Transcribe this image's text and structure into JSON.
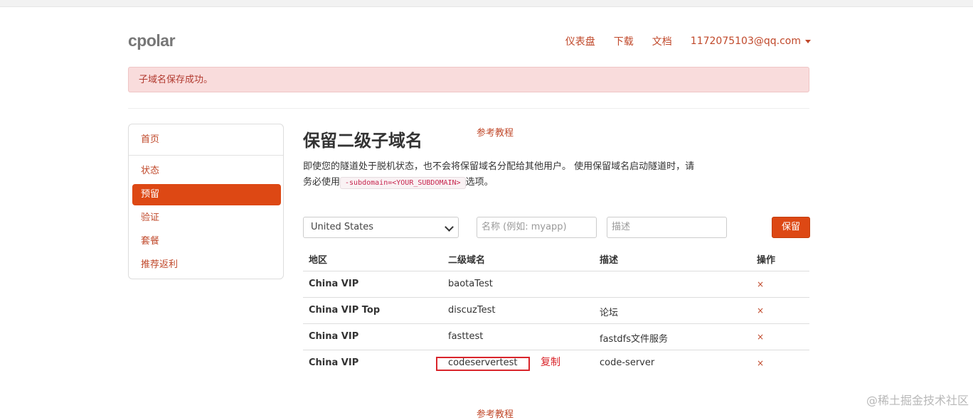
{
  "header": {
    "logo": "cpolar",
    "nav": [
      {
        "label": "仪表盘"
      },
      {
        "label": "下载"
      },
      {
        "label": "文档"
      },
      {
        "label": "1172075103@qq.com"
      }
    ]
  },
  "alert": {
    "text": "子域名保存成功。"
  },
  "sidebar": {
    "items": [
      {
        "label": "首页"
      },
      {
        "label": "状态"
      },
      {
        "label": "预留"
      },
      {
        "label": "验证"
      },
      {
        "label": "套餐"
      },
      {
        "label": "推荐返利"
      }
    ]
  },
  "main": {
    "title": "保留二级子域名",
    "ref_link": "参考教程",
    "desc_part1": "即使您的隧道处于脱机状态，也不会将保留域名分配给其他用户。 使用保留域名启动隧道时，请务必使用",
    "desc_code": "-subdomain=<YOUR_SUBDOMAIN>",
    "desc_part2": "选项。",
    "form": {
      "region_selected": "United States",
      "name_placeholder": "名称 (例如: myapp)",
      "desc_placeholder": "描述",
      "submit_label": "保留"
    },
    "table": {
      "headers": [
        "地区",
        "二级域名",
        "描述",
        "操作"
      ],
      "rows": [
        {
          "region": "China VIP",
          "subdomain": "baotaTest",
          "desc": "",
          "action": "×"
        },
        {
          "region": "China VIP Top",
          "subdomain": "discuzTest",
          "desc": "论坛",
          "action": "×"
        },
        {
          "region": "China VIP",
          "subdomain": "fasttest",
          "desc": "fastdfs文件服务",
          "action": "×"
        },
        {
          "region": "China VIP",
          "subdomain": "codeservertest",
          "desc": "code-server",
          "action": "×"
        }
      ]
    },
    "annotation": "复制",
    "bottom_link": "参考教程"
  },
  "watermark": "@稀土掘金技术社区",
  "colors": {
    "accent": "#dd4814",
    "link": "#c0482a",
    "alert_bg": "#f9dcdc",
    "annotation": "#d9252b"
  }
}
